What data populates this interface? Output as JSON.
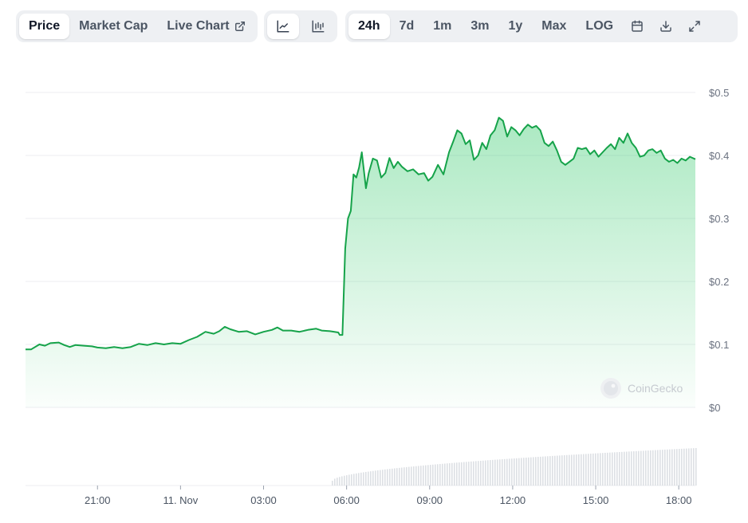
{
  "tabs": {
    "price": "Price",
    "market_cap": "Market Cap",
    "live_chart": "Live Chart"
  },
  "chart_modes": {
    "line_icon": "line-chart-icon",
    "candle_icon": "candlestick-chart-icon"
  },
  "ranges": [
    "24h",
    "7d",
    "1m",
    "3m",
    "1y",
    "Max"
  ],
  "log_label": "LOG",
  "tools": {
    "calendar_icon": "calendar-icon",
    "download_icon": "download-icon",
    "expand_icon": "expand-icon"
  },
  "watermark": "CoinGecko",
  "colors": {
    "line": "#16a34a",
    "fill": "#22c55e",
    "volume": "#d1d5db",
    "grid": "#eceef1"
  },
  "chart_data": {
    "type": "area",
    "y_tick_labels": [
      "$0",
      "$0.1",
      "$0.2",
      "$0.3",
      "$0.4",
      "$0.5"
    ],
    "ylim": [
      0,
      0.5
    ],
    "x_tick_labels": [
      "21:00",
      "11. Nov",
      "03:00",
      "06:00",
      "09:00",
      "12:00",
      "15:00",
      "18:00"
    ],
    "x_tick_hours": [
      -3,
      0,
      3,
      6,
      9,
      12,
      15,
      18
    ],
    "xlim": [
      -5.6,
      18.6
    ],
    "grid": true,
    "price_points": [
      [
        -5.6,
        0.092
      ],
      [
        -5.4,
        0.092
      ],
      [
        -5.1,
        0.1
      ],
      [
        -4.9,
        0.098
      ],
      [
        -4.7,
        0.102
      ],
      [
        -4.4,
        0.103
      ],
      [
        -4.2,
        0.099
      ],
      [
        -4.0,
        0.096
      ],
      [
        -3.8,
        0.099
      ],
      [
        -3.5,
        0.098
      ],
      [
        -3.2,
        0.097
      ],
      [
        -3.0,
        0.095
      ],
      [
        -2.7,
        0.094
      ],
      [
        -2.4,
        0.096
      ],
      [
        -2.1,
        0.094
      ],
      [
        -1.8,
        0.096
      ],
      [
        -1.5,
        0.101
      ],
      [
        -1.2,
        0.099
      ],
      [
        -0.9,
        0.102
      ],
      [
        -0.6,
        0.1
      ],
      [
        -0.3,
        0.102
      ],
      [
        0.0,
        0.101
      ],
      [
        0.3,
        0.107
      ],
      [
        0.6,
        0.112
      ],
      [
        0.9,
        0.12
      ],
      [
        1.2,
        0.117
      ],
      [
        1.4,
        0.121
      ],
      [
        1.6,
        0.128
      ],
      [
        1.8,
        0.124
      ],
      [
        2.1,
        0.12
      ],
      [
        2.4,
        0.121
      ],
      [
        2.7,
        0.116
      ],
      [
        3.0,
        0.12
      ],
      [
        3.3,
        0.123
      ],
      [
        3.5,
        0.127
      ],
      [
        3.7,
        0.122
      ],
      [
        4.0,
        0.122
      ],
      [
        4.3,
        0.12
      ],
      [
        4.6,
        0.123
      ],
      [
        4.9,
        0.125
      ],
      [
        5.1,
        0.122
      ],
      [
        5.4,
        0.121
      ],
      [
        5.7,
        0.119
      ],
      [
        5.75,
        0.115
      ],
      [
        5.85,
        0.115
      ],
      [
        5.95,
        0.252
      ],
      [
        6.05,
        0.3
      ],
      [
        6.15,
        0.312
      ],
      [
        6.25,
        0.37
      ],
      [
        6.35,
        0.365
      ],
      [
        6.45,
        0.381
      ],
      [
        6.55,
        0.405
      ],
      [
        6.7,
        0.348
      ],
      [
        6.8,
        0.372
      ],
      [
        6.95,
        0.395
      ],
      [
        7.1,
        0.392
      ],
      [
        7.25,
        0.365
      ],
      [
        7.4,
        0.372
      ],
      [
        7.55,
        0.396
      ],
      [
        7.7,
        0.38
      ],
      [
        7.85,
        0.39
      ],
      [
        8.0,
        0.382
      ],
      [
        8.2,
        0.375
      ],
      [
        8.4,
        0.378
      ],
      [
        8.6,
        0.37
      ],
      [
        8.8,
        0.372
      ],
      [
        8.95,
        0.36
      ],
      [
        9.1,
        0.366
      ],
      [
        9.3,
        0.385
      ],
      [
        9.5,
        0.37
      ],
      [
        9.7,
        0.405
      ],
      [
        9.85,
        0.422
      ],
      [
        10.0,
        0.44
      ],
      [
        10.15,
        0.435
      ],
      [
        10.3,
        0.418
      ],
      [
        10.45,
        0.424
      ],
      [
        10.6,
        0.393
      ],
      [
        10.75,
        0.4
      ],
      [
        10.9,
        0.42
      ],
      [
        11.05,
        0.41
      ],
      [
        11.2,
        0.432
      ],
      [
        11.35,
        0.44
      ],
      [
        11.5,
        0.46
      ],
      [
        11.65,
        0.455
      ],
      [
        11.8,
        0.43
      ],
      [
        11.95,
        0.445
      ],
      [
        12.1,
        0.44
      ],
      [
        12.25,
        0.432
      ],
      [
        12.4,
        0.442
      ],
      [
        12.55,
        0.449
      ],
      [
        12.7,
        0.444
      ],
      [
        12.85,
        0.447
      ],
      [
        13.0,
        0.44
      ],
      [
        13.15,
        0.42
      ],
      [
        13.3,
        0.415
      ],
      [
        13.45,
        0.422
      ],
      [
        13.6,
        0.408
      ],
      [
        13.75,
        0.39
      ],
      [
        13.9,
        0.385
      ],
      [
        14.05,
        0.39
      ],
      [
        14.2,
        0.395
      ],
      [
        14.35,
        0.412
      ],
      [
        14.5,
        0.41
      ],
      [
        14.65,
        0.412
      ],
      [
        14.8,
        0.402
      ],
      [
        14.95,
        0.408
      ],
      [
        15.1,
        0.398
      ],
      [
        15.25,
        0.405
      ],
      [
        15.4,
        0.412
      ],
      [
        15.55,
        0.418
      ],
      [
        15.7,
        0.41
      ],
      [
        15.85,
        0.428
      ],
      [
        16.0,
        0.42
      ],
      [
        16.15,
        0.435
      ],
      [
        16.3,
        0.42
      ],
      [
        16.45,
        0.412
      ],
      [
        16.6,
        0.398
      ],
      [
        16.75,
        0.4
      ],
      [
        16.9,
        0.408
      ],
      [
        17.05,
        0.41
      ],
      [
        17.2,
        0.404
      ],
      [
        17.35,
        0.408
      ],
      [
        17.5,
        0.395
      ],
      [
        17.65,
        0.39
      ],
      [
        17.8,
        0.393
      ],
      [
        17.95,
        0.388
      ],
      [
        18.1,
        0.395
      ],
      [
        18.25,
        0.392
      ],
      [
        18.4,
        0.398
      ],
      [
        18.6,
        0.394
      ]
    ]
  }
}
